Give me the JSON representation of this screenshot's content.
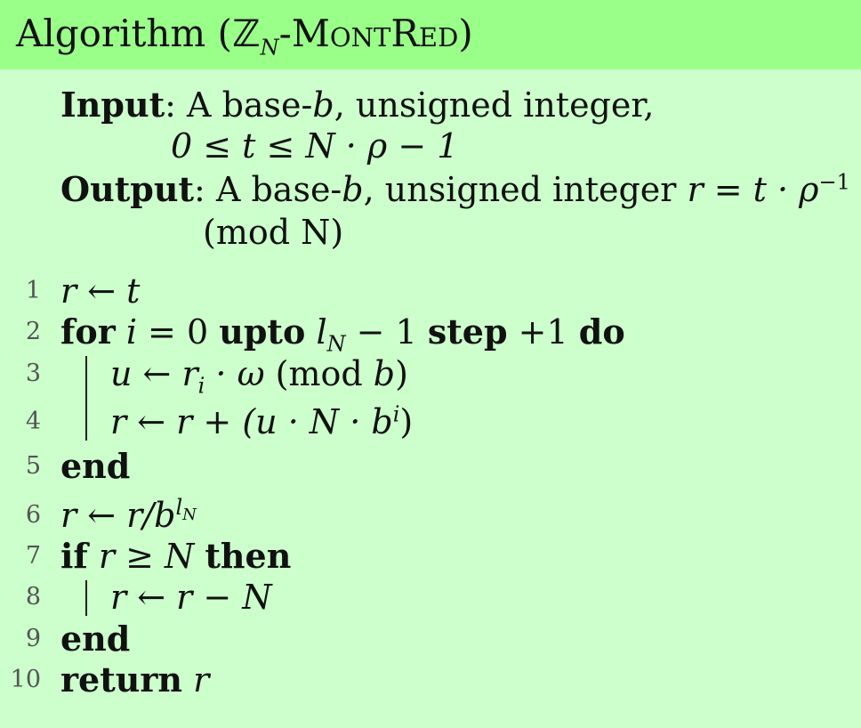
{
  "title": {
    "prefix": "Algorithm (",
    "ring": "ℤ",
    "ring_sub": "N",
    "name": "-MontRed",
    "suffix": ")"
  },
  "input": {
    "label": "Input",
    "line1_a": "A base-",
    "line1_b": "b",
    "line1_c": ", unsigned integer,",
    "line2": "0 ≤ t ≤ N · ρ − 1"
  },
  "output": {
    "label": "Output",
    "line1_a": "A base-",
    "line1_b": "b",
    "line1_c": ", unsigned integer ",
    "line1_d": "r = t · ρ",
    "line1_sup": "−1",
    "line2": "(mod N)"
  },
  "lines": {
    "n1": "1",
    "n2": "2",
    "n3": "3",
    "n4": "4",
    "n5": "5",
    "n6": "6",
    "n7": "7",
    "n8": "8",
    "n9": "9",
    "n10": "10",
    "l1": "r ← t",
    "l2_for": "for",
    "l2_a": "i",
    "l2_b": " = 0 ",
    "l2_upto": "upto",
    "l2_c": "l",
    "l2_c_sub": "N",
    "l2_d": " − 1 ",
    "l2_step": "step",
    "l2_e": " +1 ",
    "l2_do": "do",
    "l3_a": "u ← r",
    "l3_sub": "i",
    "l3_b": " · ω",
    "l3_c": "  (mod ",
    "l3_d": "b",
    "l3_e": ")",
    "l4_a": "r ← r + (u · N · b",
    "l4_sup": "i",
    "l4_b": ")",
    "l5": "end",
    "l6_a": "r ← r/b",
    "l6_sup": "l",
    "l6_sup_sub": "N",
    "l7_if": "if",
    "l7_a": " r ≥ N ",
    "l7_then": "then",
    "l8": "r ← r − N",
    "l9": "end",
    "l10_ret": "return",
    "l10_a": " r"
  }
}
